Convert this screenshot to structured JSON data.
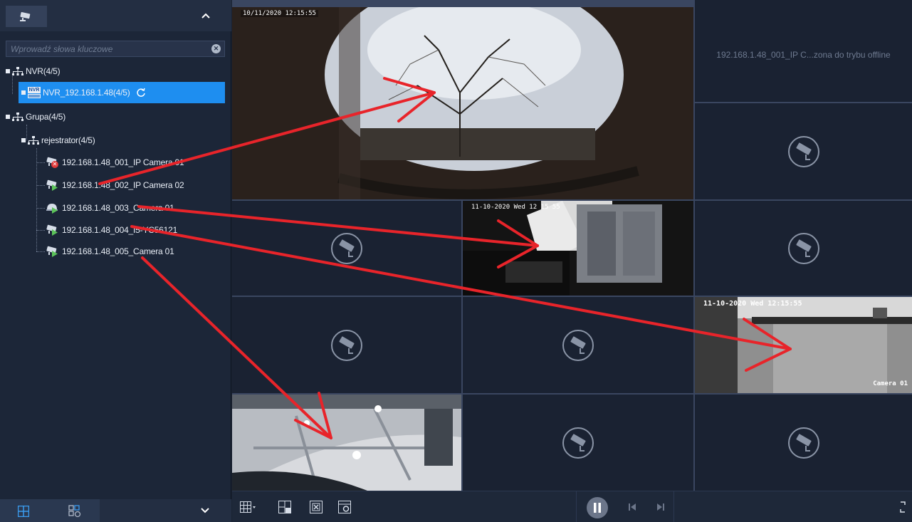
{
  "sidebar": {
    "search": {
      "placeholder": "Wprowadź słowa kluczowe",
      "value": ""
    },
    "tree": {
      "nvr_root": "NVR(4/5)",
      "nvr_device": "NVR_192.168.1.48(4/5)",
      "nvr_badge": "NVR",
      "group_root": "Grupa(4/5)",
      "recorder": "rejestrator(4/5)",
      "cameras": [
        {
          "label": "192.168.1.48_001_IP Camera 01",
          "status": "offline"
        },
        {
          "label": "192.168.1.48_002_IP Camera 02",
          "status": "online"
        },
        {
          "label": "192.168.1.48_003_Camera 01",
          "status": "online"
        },
        {
          "label": "192.168.1.48_004_I5-YC56121",
          "status": "online"
        },
        {
          "label": "192.168.1.48_005_Camera 01",
          "status": "online"
        }
      ]
    }
  },
  "grid": {
    "offline_message": "192.168.1.48_001_IP C...zona do trybu offline",
    "osd": {
      "tile1": "10/11/2020 12:15:55",
      "tile6": "11-10-2020 Wed 12 15 55",
      "tile9": "11-10-2020 Wed 12:15:55",
      "tile9_name": "Camera 01"
    }
  },
  "colors": {
    "accent": "#1e8ef0",
    "active_tile": "#e2a23a",
    "annotation": "#e8242a"
  }
}
